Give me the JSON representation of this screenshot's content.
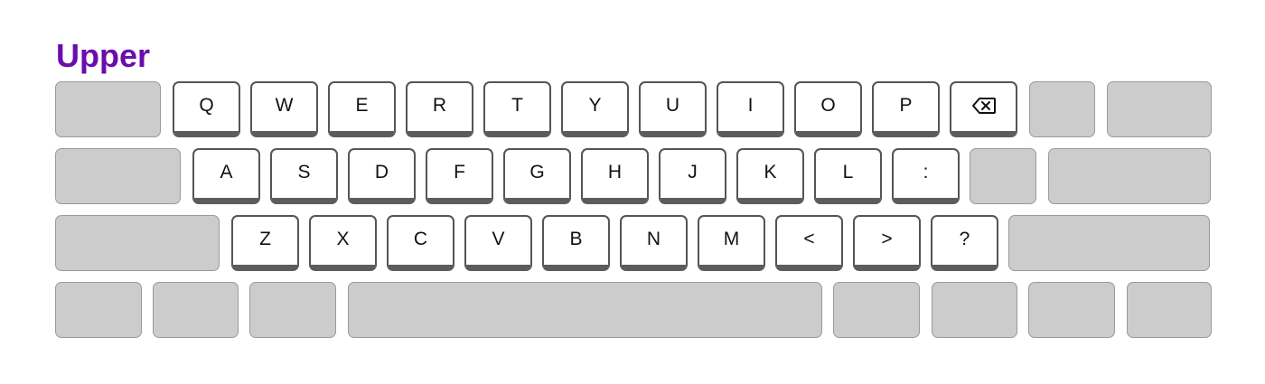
{
  "layout_title": "Upper",
  "rows": [
    [
      "",
      "Q",
      "W",
      "E",
      "R",
      "T",
      "Y",
      "U",
      "I",
      "O",
      "P",
      "backspace",
      "",
      ""
    ],
    [
      "",
      "A",
      "S",
      "D",
      "F",
      "G",
      "H",
      "J",
      "K",
      "L",
      ":",
      "",
      ""
    ],
    [
      "",
      "Z",
      "X",
      "C",
      "V",
      "B",
      "N",
      "M",
      "<",
      ">",
      "?",
      ""
    ],
    [
      "",
      "",
      "",
      "",
      "",
      "",
      "",
      ""
    ]
  ],
  "icons": {
    "backspace": "backspace-icon"
  },
  "colors": {
    "title": "#6a0dad",
    "blank_key": "#cccccc",
    "key_face": "#ffffff",
    "key_edge": "#5c5c5c"
  }
}
